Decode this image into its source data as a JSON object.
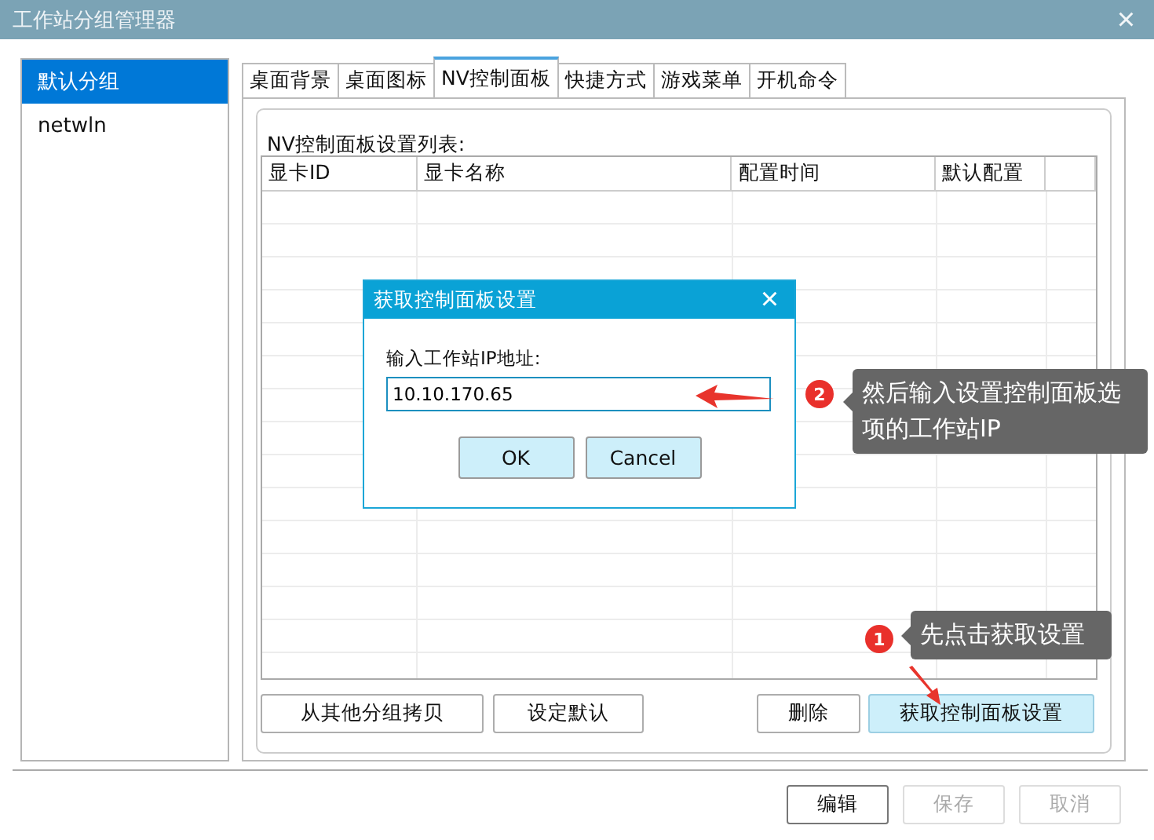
{
  "window": {
    "title": "工作站分组管理器",
    "close": "×"
  },
  "sidebar": {
    "items": [
      {
        "label": "默认分组",
        "selected": true
      },
      {
        "label": "netwln",
        "selected": false
      }
    ]
  },
  "tabs": [
    {
      "label": "桌面背景",
      "selected": false
    },
    {
      "label": "桌面图标",
      "selected": false
    },
    {
      "label": "NV控制面板",
      "selected": true
    },
    {
      "label": "快捷方式",
      "selected": false
    },
    {
      "label": "游戏菜单",
      "selected": false
    },
    {
      "label": "开机命令",
      "selected": false
    }
  ],
  "panel": {
    "list_label": "NV控制面板设置列表:",
    "table": {
      "columns": [
        "显卡ID",
        "显卡名称",
        "配置时间",
        "默认配置"
      ]
    },
    "buttons": [
      {
        "label": "从其他分组拷贝",
        "highlighted": false
      },
      {
        "label": "设定默认",
        "highlighted": false
      },
      {
        "label": "删除",
        "highlighted": false
      },
      {
        "label": "获取控制面板设置",
        "highlighted": true
      }
    ]
  },
  "footer_buttons": [
    {
      "label": "编辑",
      "disabled": false
    },
    {
      "label": "保存",
      "disabled": true
    },
    {
      "label": "取消",
      "disabled": true
    }
  ],
  "dialog": {
    "title": "获取控制面板设置",
    "close": "×",
    "field_label": "输入工作站IP地址:",
    "ip_value": "10.10.170.65",
    "buttons": [
      "OK",
      "Cancel"
    ]
  },
  "annotations": [
    {
      "number": "2",
      "text": "然后输入设置控制面板选项的工作站IP"
    },
    {
      "number": "1",
      "text": "先点击获取设置"
    }
  ]
}
